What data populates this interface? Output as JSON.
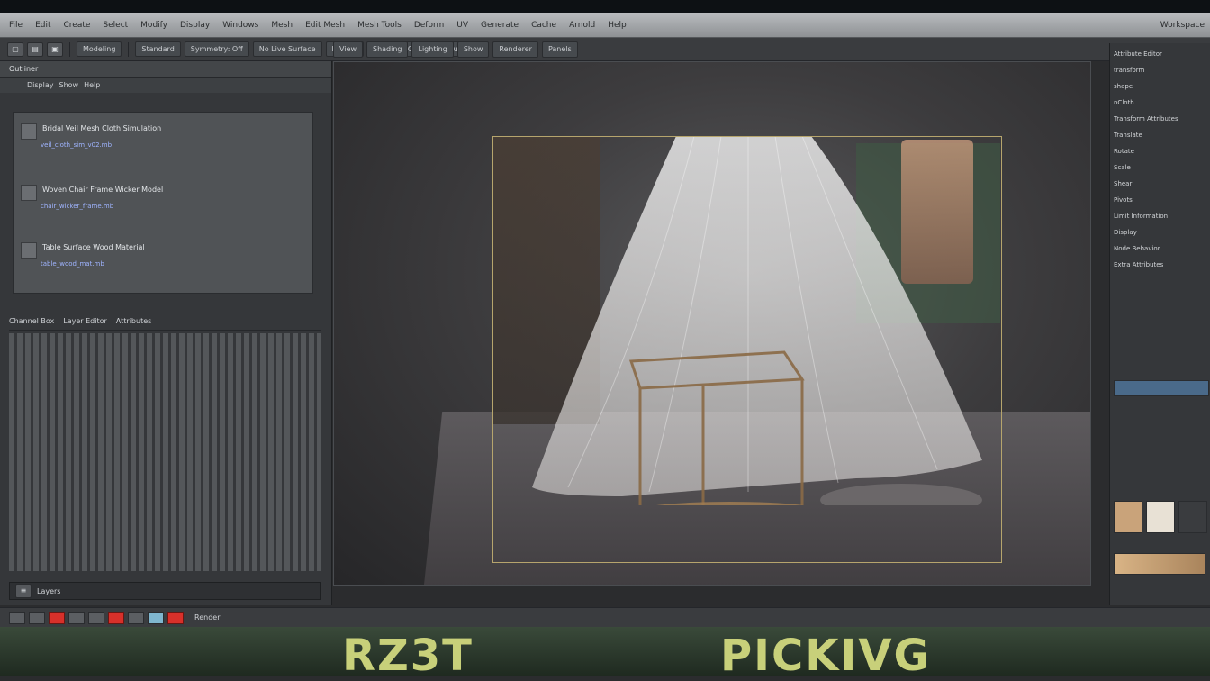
{
  "menubar": {
    "items": [
      "File",
      "Edit",
      "Create",
      "Select",
      "Modify",
      "Display",
      "Windows",
      "Mesh",
      "Edit Mesh",
      "Mesh Tools",
      "Deform",
      "UV",
      "Generate",
      "Cache",
      "Arnold",
      "Help"
    ],
    "workspace": "Workspace"
  },
  "toolbar": {
    "mode": "Modeling",
    "items": [
      "Standard",
      "Symmetry: Off",
      "No Live Surface",
      "Render",
      "Paint",
      "Curves",
      "Surfaces"
    ]
  },
  "viewport": {
    "tabs": [
      "View",
      "Shading",
      "Lighting",
      "Show",
      "Renderer",
      "Panels"
    ]
  },
  "leftpanel": {
    "header": "Outliner",
    "sub": [
      "Display",
      "Show",
      "Help"
    ],
    "assets": [
      {
        "title": "Bridal Veil Mesh Cloth Simulation",
        "meta": "veil_cloth_sim_v02.mb"
      },
      {
        "title": "Woven Chair Frame Wicker Model",
        "meta": "chair_wicker_frame.mb"
      },
      {
        "title": "Table Surface Wood Material",
        "meta": "table_wood_mat.mb"
      }
    ],
    "attr_header": [
      "Channel Box",
      "Layer Editor",
      "Attributes"
    ],
    "footer": "Layers"
  },
  "rightpanel": {
    "rows": [
      "Attribute Editor",
      "transform",
      "shape",
      "nCloth",
      "Transform Attributes",
      "Translate",
      "Rotate",
      "Scale",
      "Shear",
      "Pivots",
      "Limit Information",
      "Display",
      "Node Behavior",
      "Extra Attributes"
    ]
  },
  "status": {
    "label": "Render"
  },
  "banner": {
    "left": "RZ3T",
    "right": "PICKIVG"
  }
}
